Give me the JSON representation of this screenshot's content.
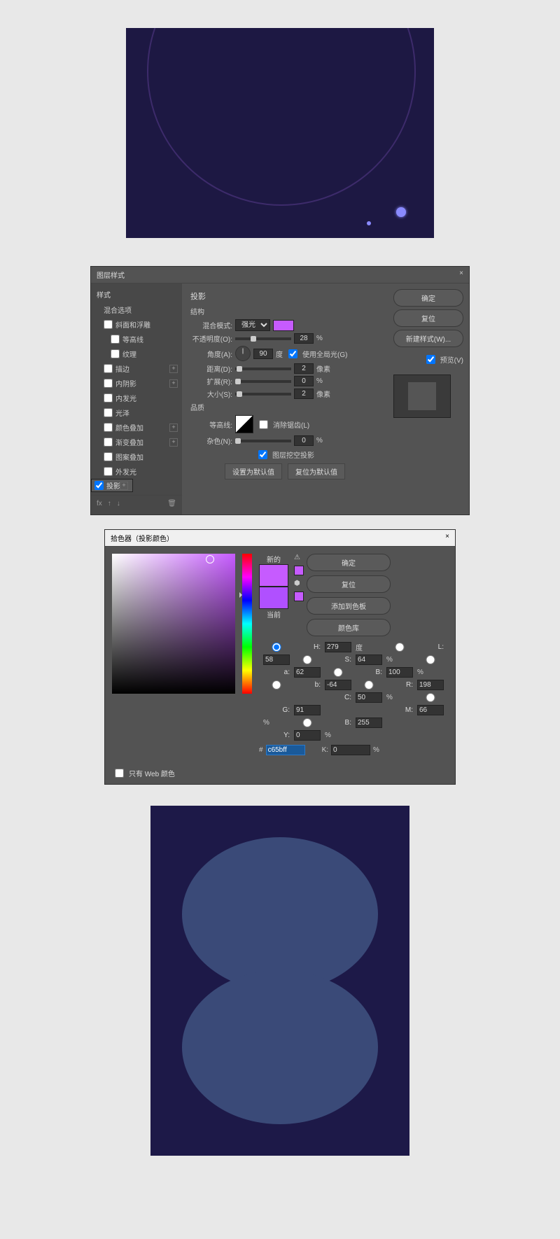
{
  "layerStyle": {
    "title": "图层样式",
    "sidebarHead": "样式",
    "blendOptions": "混合选项",
    "items": [
      {
        "label": "斜面和浮雕",
        "checked": false,
        "plus": false
      },
      {
        "label": "等高线",
        "checked": false,
        "plus": false,
        "indent": true
      },
      {
        "label": "纹理",
        "checked": false,
        "plus": false,
        "indent": true
      },
      {
        "label": "描边",
        "checked": false,
        "plus": true
      },
      {
        "label": "内阴影",
        "checked": false,
        "plus": true
      },
      {
        "label": "内发光",
        "checked": false,
        "plus": false
      },
      {
        "label": "光泽",
        "checked": false,
        "plus": false
      },
      {
        "label": "颜色叠加",
        "checked": false,
        "plus": true
      },
      {
        "label": "渐变叠加",
        "checked": false,
        "plus": true
      },
      {
        "label": "图案叠加",
        "checked": false,
        "plus": false
      },
      {
        "label": "外发光",
        "checked": false,
        "plus": false
      },
      {
        "label": "投影",
        "checked": true,
        "plus": true,
        "sel": true
      }
    ],
    "section": "投影",
    "structure": "结构",
    "blendMode": {
      "label": "混合模式:",
      "value": "强光"
    },
    "opacity": {
      "label": "不透明度(O):",
      "value": "28",
      "unit": "%"
    },
    "angle": {
      "label": "角度(A):",
      "value": "90",
      "unit": "度",
      "globalLabel": "使用全局光(G)"
    },
    "distance": {
      "label": "距离(D):",
      "value": "2",
      "unit": "像素"
    },
    "spread": {
      "label": "扩展(R):",
      "value": "0",
      "unit": "%"
    },
    "size": {
      "label": "大小(S):",
      "value": "2",
      "unit": "像素"
    },
    "quality": "品质",
    "contour": {
      "label": "等高线:",
      "antiAlias": "消除锯齿(L)"
    },
    "noise": {
      "label": "杂色(N):",
      "value": "0",
      "unit": "%"
    },
    "knockout": "图层挖空投影",
    "makeDefault": "设置为默认值",
    "resetDefault": "复位为默认值",
    "buttons": {
      "ok": "确定",
      "cancel": "复位",
      "newStyle": "新建样式(W)...",
      "preview": "预览(V)"
    },
    "fx": "fx"
  },
  "colorPicker": {
    "title": "拾色器（投影颜色）",
    "new": "新的",
    "current": "当前",
    "ok": "确定",
    "cancel": "复位",
    "addSwatch": "添加到色板",
    "colorLib": "颜色库",
    "webOnly": "只有 Web 颜色",
    "hex": "c65bff",
    "fields": {
      "H": {
        "v": "279",
        "u": "度"
      },
      "L": {
        "v": "58"
      },
      "S": {
        "v": "64",
        "u": "%"
      },
      "a": {
        "v": "62"
      },
      "B": {
        "v": "100",
        "u": "%"
      },
      "b": {
        "v": "-64"
      },
      "R": {
        "v": "198"
      },
      "C": {
        "v": "50",
        "u": "%"
      },
      "G": {
        "v": "91"
      },
      "M": {
        "v": "66",
        "u": "%"
      },
      "Bb": {
        "v": "255"
      },
      "Y": {
        "v": "0",
        "u": "%"
      },
      "K": {
        "v": "0",
        "u": "%"
      }
    }
  }
}
